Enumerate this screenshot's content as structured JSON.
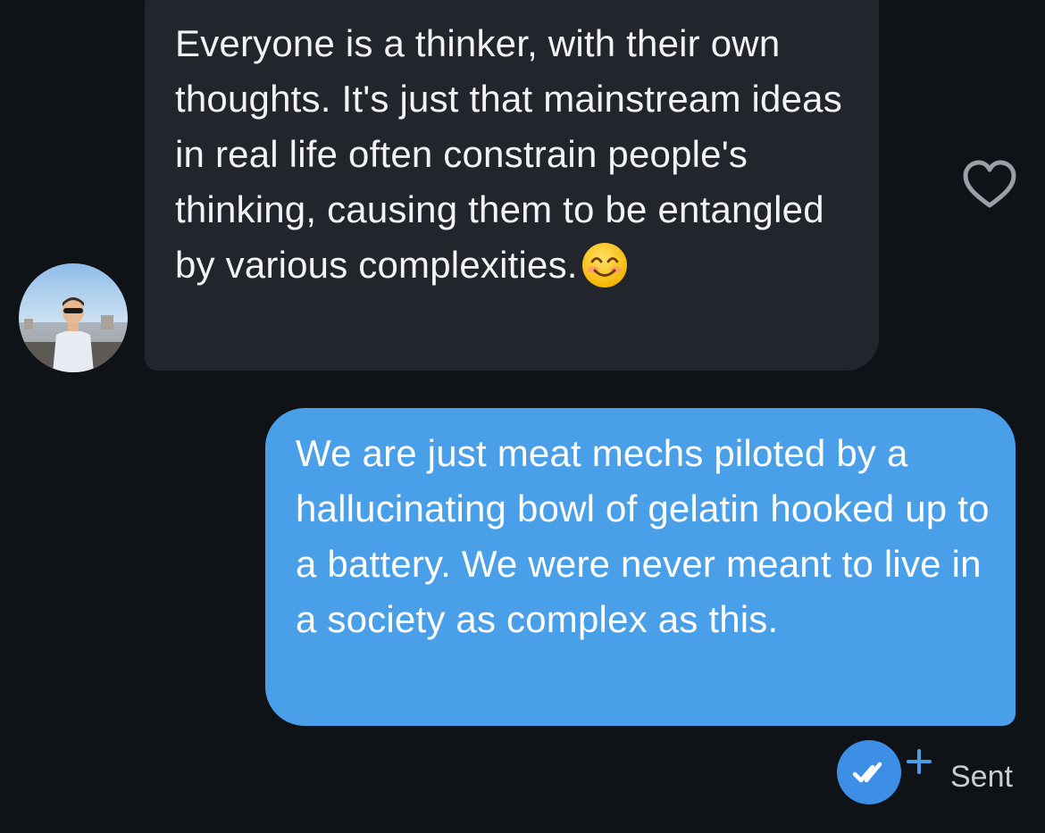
{
  "incoming_message": {
    "text": "Everyone is a thinker, with their own thoughts. It's just that mainstream ideas in real life often constrain people's thinking, causing them to be entangled by various complexities.",
    "emoji_icon": "smiling-face-with-smiling-eyes-icon",
    "reaction_icon": "heart-outline-icon",
    "avatar_icon": "sender-avatar"
  },
  "outgoing_message": {
    "text": "We are just meat mechs piloted by a hallucinating bowl of gelatin hooked up to a battery. We were never meant to live in a society as complex as this."
  },
  "delivery": {
    "status_icon": "double-check-icon",
    "add_icon": "plus-icon",
    "status_label": "Sent"
  },
  "colors": {
    "background": "#0f1216",
    "incoming_bubble": "#22252b",
    "outgoing_bubble": "#4a9fe9",
    "status_circle": "#3d8fe5",
    "accent_plus": "#4a9fe9"
  }
}
